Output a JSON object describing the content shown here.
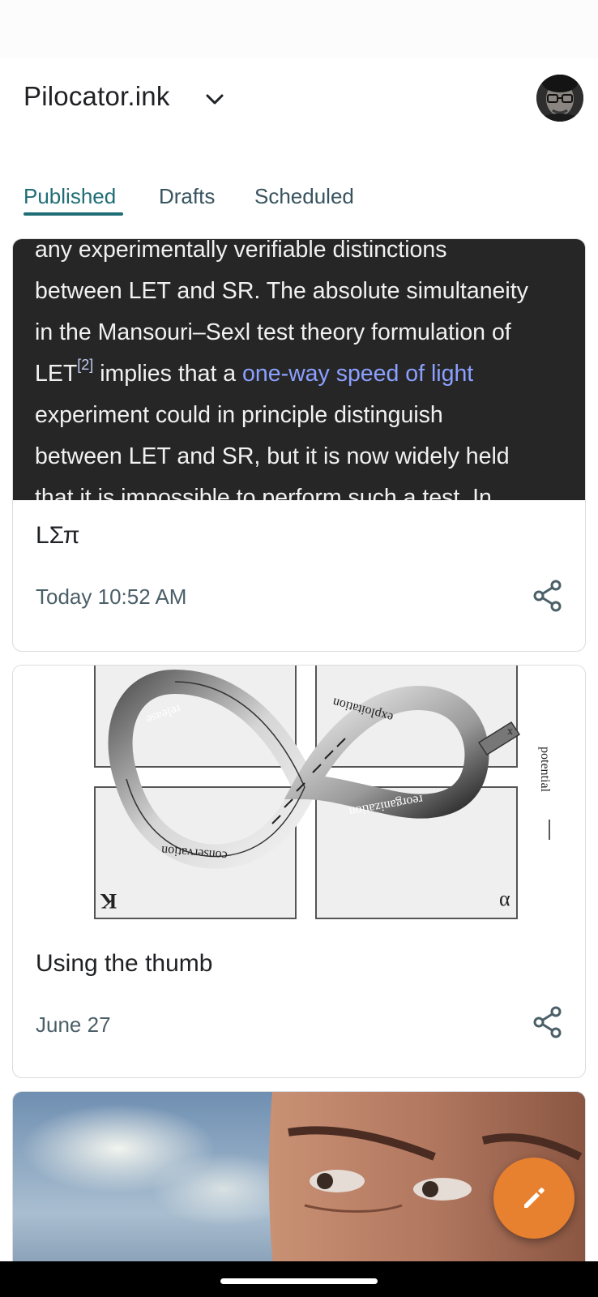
{
  "header": {
    "blog_name": "Pilocator.ink"
  },
  "tabs": [
    {
      "label": "Published",
      "active": true
    },
    {
      "label": "Drafts",
      "active": false
    },
    {
      "label": "Scheduled",
      "active": false
    }
  ],
  "posts": [
    {
      "title": "LΣπ",
      "date": "Today 10:52 AM",
      "thumbnail_text": {
        "line1": "any experimentally verifiable distinctions",
        "line2": "between LET and SR. The absolute simultaneity",
        "line3": "in the Mansouri–Sexl test theory formulation of",
        "line4_a": "LET",
        "line4_sup": "[2]",
        "line4_b": " implies that a ",
        "line4_link": "one-way speed of light",
        "line5": "experiment could in principle distinguish",
        "line6": "between LET and SR, but it is now widely held",
        "line7": "that it is impossible to perform such a test. In"
      }
    },
    {
      "title": "Using the thumb",
      "date": "June 27",
      "thumbnail_labels": {
        "release": "release",
        "exploitation": "exploitation",
        "reorganization": "reorganization",
        "conservation": "conservation",
        "potential": "potential",
        "k": "K",
        "alpha": "α",
        "x": "x"
      }
    },
    {
      "title": "",
      "date": ""
    }
  ],
  "colors": {
    "accent": "#1f6e75",
    "fab": "#e8812f",
    "link": "#8ba0ff"
  },
  "icons": {
    "dropdown": "chevron-down-icon",
    "share": "share-icon",
    "fab": "pencil-icon"
  }
}
